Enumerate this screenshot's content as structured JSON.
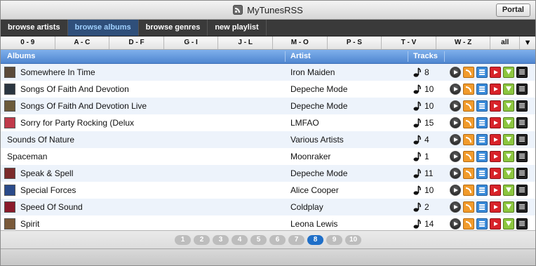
{
  "window": {
    "title": "MyTunesRSS",
    "portal_label": "Portal"
  },
  "nav": {
    "tabs": [
      {
        "label": "browse artists",
        "active": false
      },
      {
        "label": "browse albums",
        "active": true
      },
      {
        "label": "browse genres",
        "active": false
      },
      {
        "label": "new playlist",
        "active": false
      }
    ]
  },
  "letters": [
    "0 - 9",
    "A - C",
    "D - F",
    "G - I",
    "J - L",
    "M - O",
    "P - S",
    "T - V",
    "W - Z",
    "all"
  ],
  "table": {
    "headers": {
      "album": "Albums",
      "artist": "Artist",
      "tracks": "Tracks"
    },
    "rows": [
      {
        "album": "Somewhere In Time",
        "artist": "Iron Maiden",
        "tracks": "8",
        "thumb": "#5a4a3a"
      },
      {
        "album": "Songs Of Faith And Devotion",
        "artist": "Depeche Mode",
        "tracks": "10",
        "thumb": "#2a3540"
      },
      {
        "album": "Songs Of Faith And Devotion Live",
        "artist": "Depeche Mode",
        "tracks": "10",
        "thumb": "#6b5a3a"
      },
      {
        "album": "Sorry for Party Rocking (Delux",
        "artist": "LMFAO",
        "tracks": "15",
        "thumb": "#c03a4a"
      },
      {
        "album": "Sounds Of Nature",
        "artist": "Various Artists",
        "tracks": "4",
        "thumb": ""
      },
      {
        "album": "Spaceman",
        "artist": "Moonraker",
        "tracks": "1",
        "thumb": ""
      },
      {
        "album": "Speak & Spell",
        "artist": "Depeche Mode",
        "tracks": "11",
        "thumb": "#7a2a2a"
      },
      {
        "album": "Special Forces",
        "artist": "Alice Cooper",
        "tracks": "10",
        "thumb": "#2a4a8a"
      },
      {
        "album": "Speed Of Sound",
        "artist": "Coldplay",
        "tracks": "2",
        "thumb": "#8a1a2a"
      },
      {
        "album": "Spirit",
        "artist": "Leona Lewis",
        "tracks": "14",
        "thumb": "#7a5a3a"
      }
    ]
  },
  "pager": {
    "pages": [
      "1",
      "2",
      "3",
      "4",
      "5",
      "6",
      "7",
      "8",
      "9",
      "10"
    ],
    "current": "8"
  }
}
